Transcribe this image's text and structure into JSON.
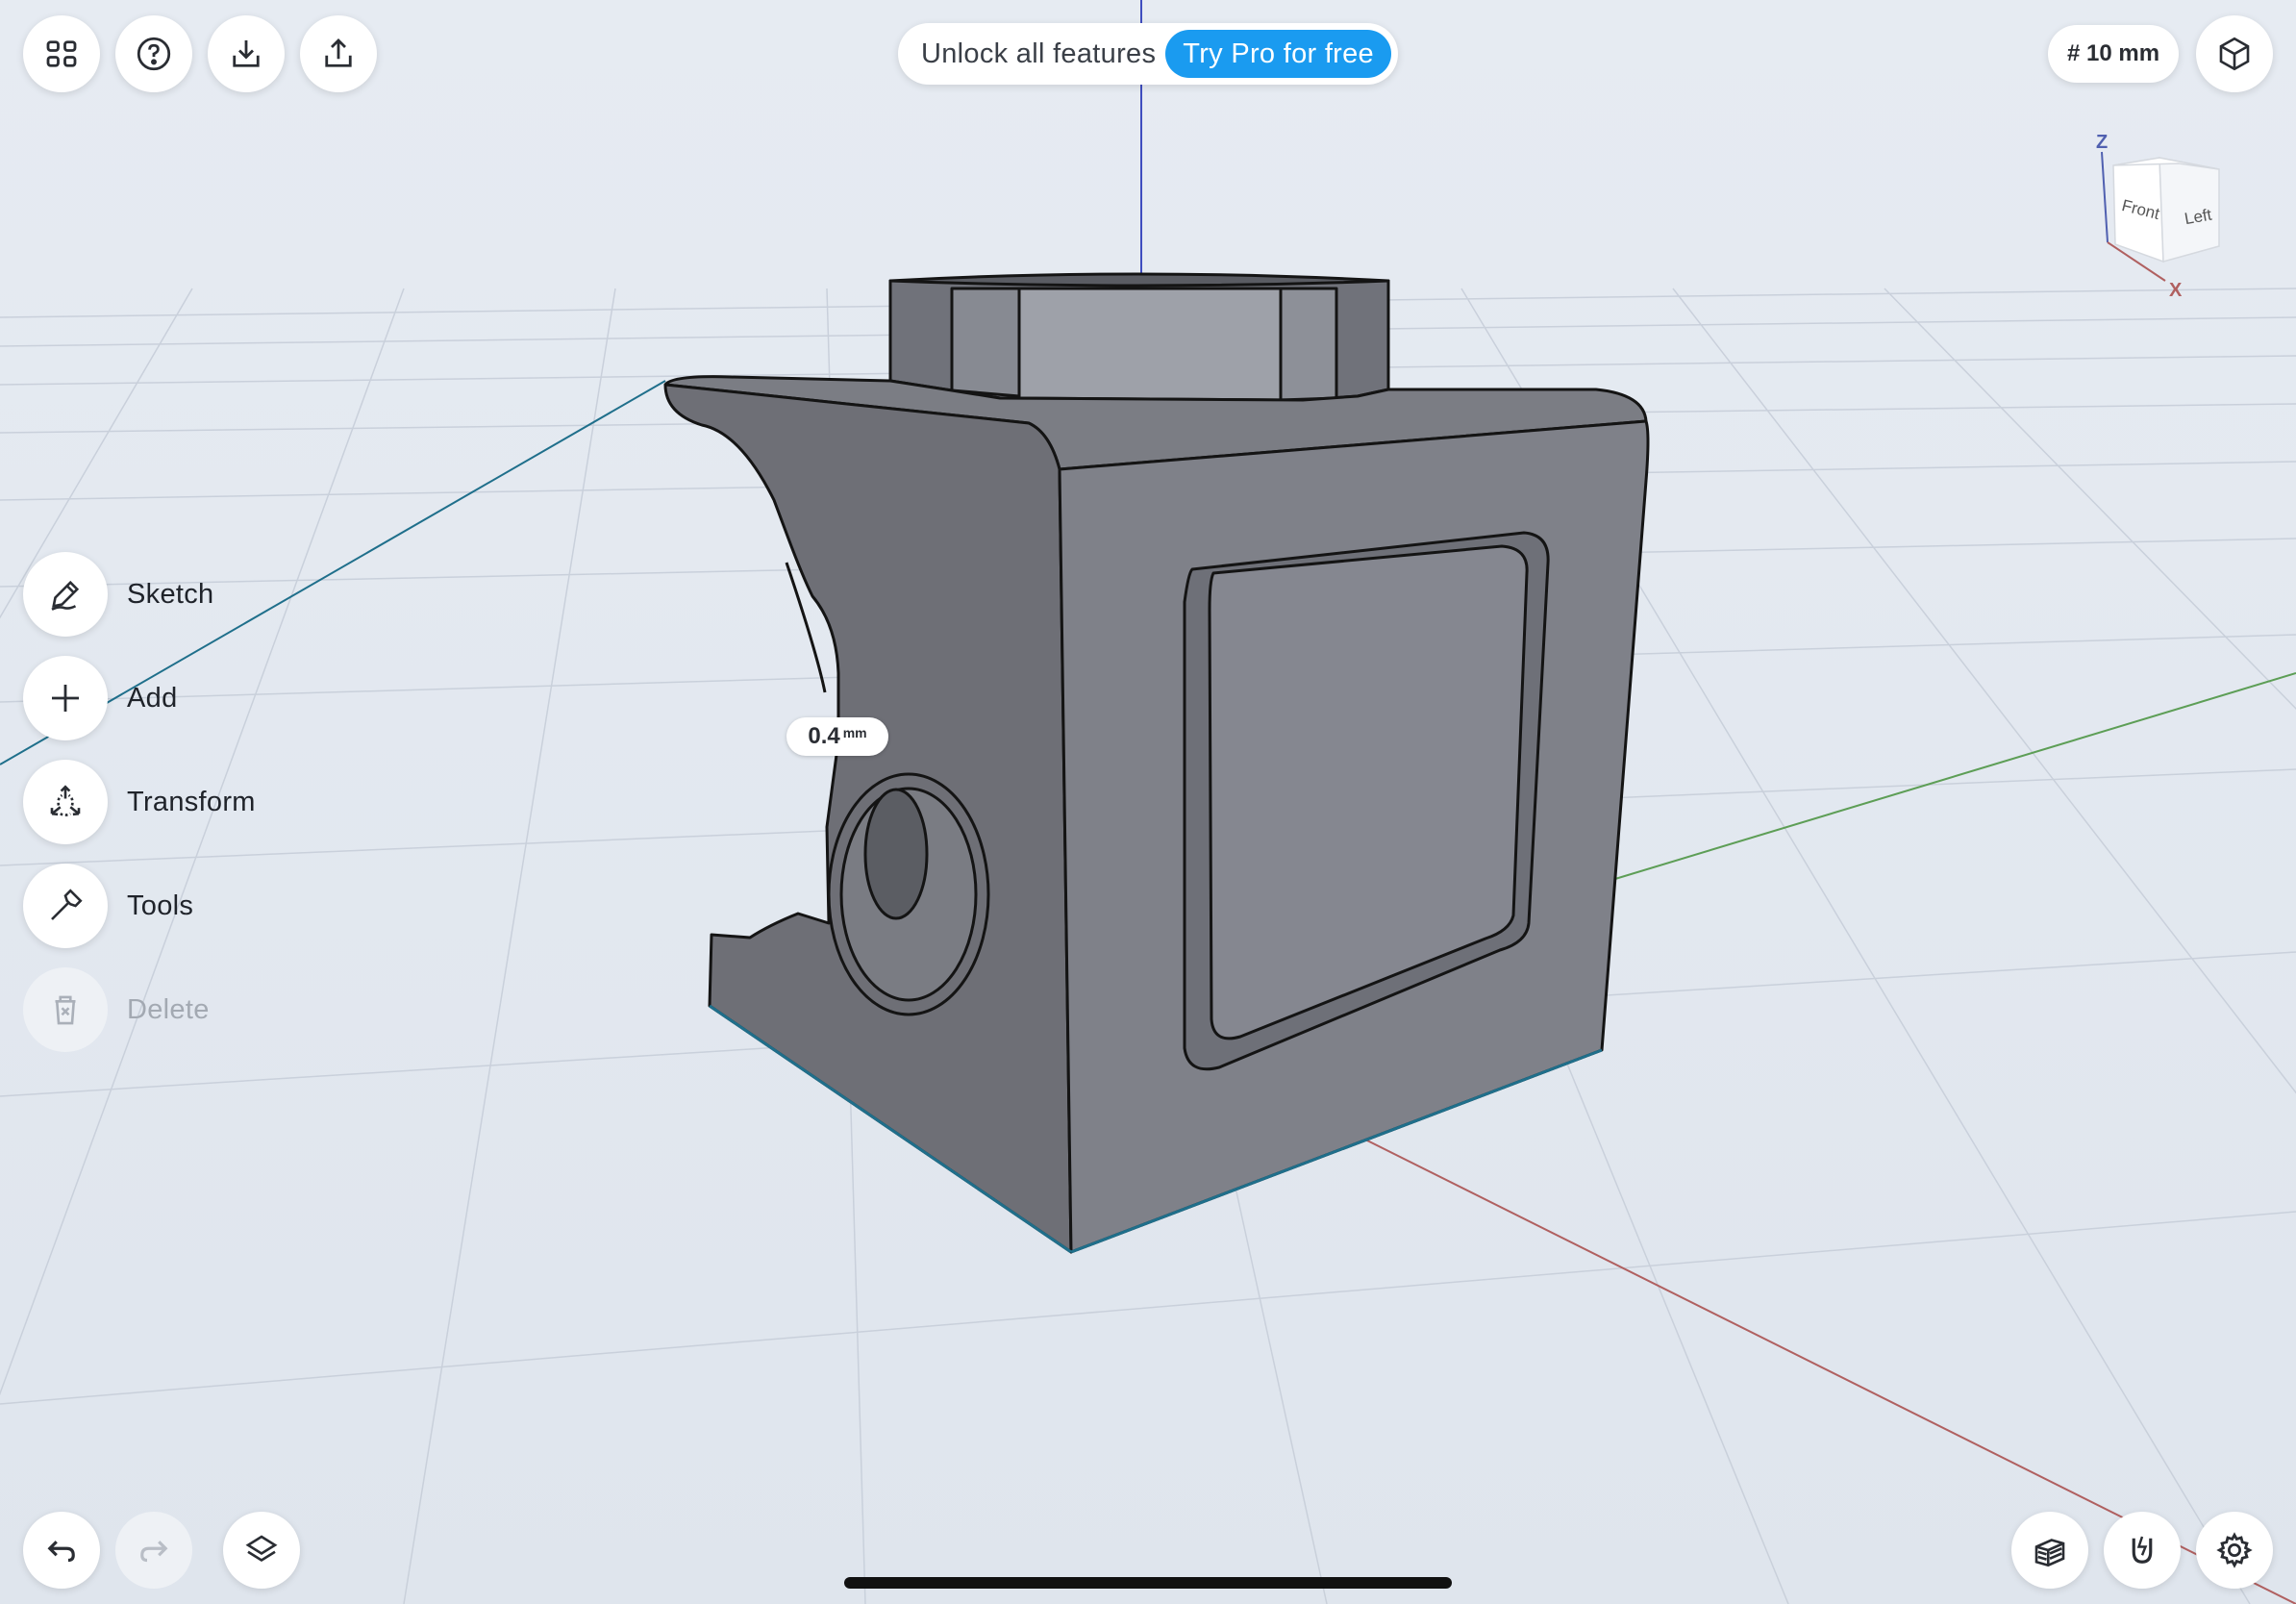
{
  "toolbar": {
    "left_icons": [
      "apps-grid-icon",
      "help-icon",
      "import-icon",
      "export-icon"
    ],
    "right_icons": [
      "view-cube-icon"
    ]
  },
  "promo": {
    "text": "Unlock all features",
    "button": "Try Pro for free",
    "accent_color": "#1a9bf0"
  },
  "grid_size": "# 10 mm",
  "view_cube": {
    "face_front": "Front",
    "face_left": "Left",
    "axis_z": "Z",
    "axis_x": "X"
  },
  "side_menu": {
    "items": [
      {
        "label": "Sketch",
        "icon": "pencil-icon",
        "enabled": true
      },
      {
        "label": "Add",
        "icon": "plus-icon",
        "enabled": true
      },
      {
        "label": "Transform",
        "icon": "transform-arrows-icon",
        "enabled": true
      },
      {
        "label": "Tools",
        "icon": "hammer-icon",
        "enabled": true
      },
      {
        "label": "Delete",
        "icon": "trash-icon",
        "enabled": false
      }
    ]
  },
  "measurement": {
    "value": "0.4",
    "unit": "mm"
  },
  "bottom_bar": {
    "left_icons": [
      "undo-icon",
      "redo-icon",
      "layers-icon"
    ],
    "right_icons": [
      "section-view-icon",
      "snap-magnet-icon",
      "settings-gear-icon"
    ]
  },
  "colors": {
    "background": "#e3e8ef",
    "model_dark": "#6e6f76",
    "model_face": "#7f8189",
    "axis_x": "#b06060",
    "axis_y": "#5d9e56",
    "axis_z": "#3f4dbf",
    "axis_teal": "#1f6f8b"
  }
}
